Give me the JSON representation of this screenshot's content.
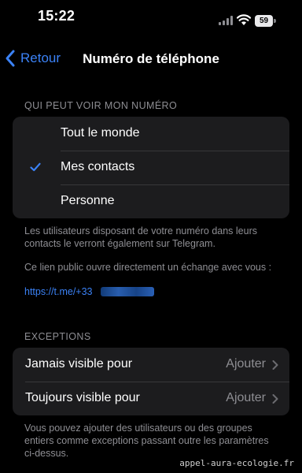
{
  "status_bar": {
    "time": "15:22",
    "battery": "59"
  },
  "nav": {
    "back_label": "Retour",
    "title": "Numéro de téléphone"
  },
  "privacy": {
    "header": "QUI PEUT VOIR MON NUMÉRO",
    "options": [
      {
        "label": "Tout le monde",
        "selected": false
      },
      {
        "label": "Mes contacts",
        "selected": true
      },
      {
        "label": "Personne",
        "selected": false
      }
    ],
    "footer": "Les utilisateurs disposant de votre numéro dans leurs contacts le verront également sur Telegram.",
    "link_note": "Ce lien public ouvre directement un échange avec vous :",
    "link_prefix": "https://t.me/+33"
  },
  "exceptions": {
    "header": "EXCEPTIONS",
    "rows": [
      {
        "label": "Jamais visible pour",
        "value": "Ajouter"
      },
      {
        "label": "Toujours visible pour",
        "value": "Ajouter"
      }
    ],
    "footer": "Vous pouvez ajouter des utilisateurs ou des groupes entiers comme exceptions passant outre les paramètres ci-dessus."
  },
  "watermark": "appel-aura-ecologie.fr",
  "colors": {
    "accent": "#3b82f6",
    "cell_background": "#1c1c1e",
    "secondary_text": "#8e8e93"
  }
}
